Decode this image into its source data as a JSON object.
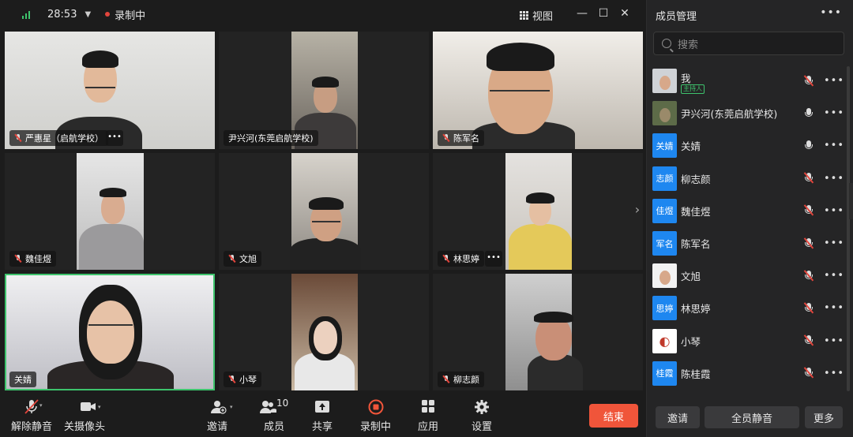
{
  "topbar": {
    "timer": "28:53",
    "recording": "录制中",
    "view_label": "视图"
  },
  "tiles": [
    {
      "name": "严惠星（启航学校）",
      "muted": true,
      "has_more": true
    },
    {
      "name": "尹兴河(东莞启航学校)",
      "muted": false,
      "has_more": false
    },
    {
      "name": "陈军名",
      "muted": true,
      "has_more": false
    },
    {
      "name": "魏佳煜",
      "muted": true,
      "has_more": false
    },
    {
      "name": "文旭",
      "muted": true,
      "has_more": false
    },
    {
      "name": "林思婷",
      "muted": true,
      "has_more": true
    },
    {
      "name": "关婧",
      "muted": false,
      "has_more": false,
      "active": true
    },
    {
      "name": "小琴",
      "muted": true,
      "has_more": false
    },
    {
      "name": "柳志颜",
      "muted": true,
      "has_more": false
    }
  ],
  "toolbar": {
    "unmute": "解除静音",
    "camera": "关摄像头",
    "invite": "邀请",
    "members": "成员",
    "member_count": "10",
    "share": "共享",
    "recording": "录制中",
    "apps": "应用",
    "settings": "设置",
    "end": "结束"
  },
  "panel": {
    "title": "成员管理",
    "search_placeholder": "搜索",
    "host_badge": "主持人",
    "members": [
      {
        "name": "我",
        "avatar": "photo",
        "mic": "muted",
        "host": true
      },
      {
        "name": "尹兴河(东莞启航学校)",
        "avatar": "photo",
        "mic": "on"
      },
      {
        "name": "关婧",
        "avatar": "关婧",
        "mic": "on"
      },
      {
        "name": "柳志颜",
        "avatar": "志颜",
        "mic": "muted"
      },
      {
        "name": "魏佳煜",
        "avatar": "佳煜",
        "mic": "muted"
      },
      {
        "name": "陈军名",
        "avatar": "军名",
        "mic": "muted"
      },
      {
        "name": "文旭",
        "avatar": "photo",
        "mic": "muted"
      },
      {
        "name": "林思婷",
        "avatar": "思婷",
        "mic": "muted"
      },
      {
        "name": "小琴",
        "avatar": "logo",
        "mic": "muted"
      },
      {
        "name": "陈桂霞",
        "avatar": "桂霞",
        "mic": "muted"
      }
    ],
    "invite_btn": "邀请",
    "mute_all_btn": "全员静音",
    "more_btn": "更多"
  },
  "colors": {
    "accent_green": "#3ec46d",
    "end_red": "#f0553a",
    "avatar_blue": "#1e87f0",
    "muted_red": "#e2453c"
  }
}
